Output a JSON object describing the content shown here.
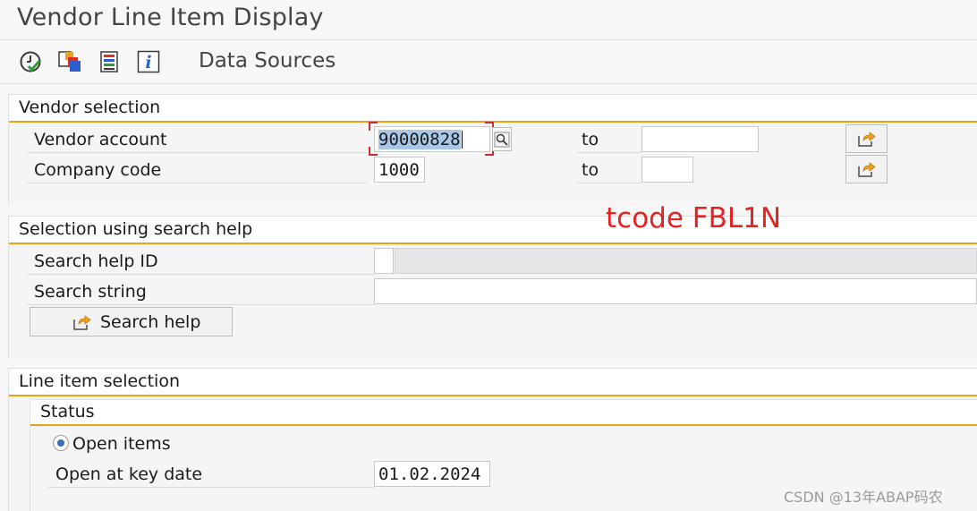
{
  "window": {
    "title": "Vendor Line Item Display"
  },
  "toolbar": {
    "execute_icon": "execute-clock-icon",
    "sources_icon": "copy-sources-icon",
    "list_icon": "list-icon",
    "info_icon": "info-icon",
    "data_sources_label": "Data Sources"
  },
  "vendor_selection": {
    "title": "Vendor selection",
    "vendor_account_label": "Vendor account",
    "vendor_account_value": "90000828",
    "vendor_account_to_label": "to",
    "vendor_account_to_value": "",
    "company_code_label": "Company code",
    "company_code_value": "1000",
    "company_code_to_label": "to",
    "company_code_to_value": ""
  },
  "search_help": {
    "title": "Selection using search help",
    "search_help_id_label": "Search help ID",
    "search_help_id_value": "",
    "search_string_label": "Search string",
    "search_string_value": "",
    "button_label": "Search help"
  },
  "line_item_selection": {
    "title": "Line item selection",
    "status_title": "Status",
    "open_items_label": "Open items",
    "open_at_key_date_label": "Open at key date",
    "open_at_key_date_value": "01.02.2024"
  },
  "annotation": {
    "text": "tcode FBL1N",
    "color": "#e52222"
  },
  "watermark": {
    "text": "CSDN @13年ABAP码农"
  },
  "colors": {
    "accent": "#e8a317",
    "selection": "#a9c7e6",
    "focus": "#d62b2b"
  }
}
